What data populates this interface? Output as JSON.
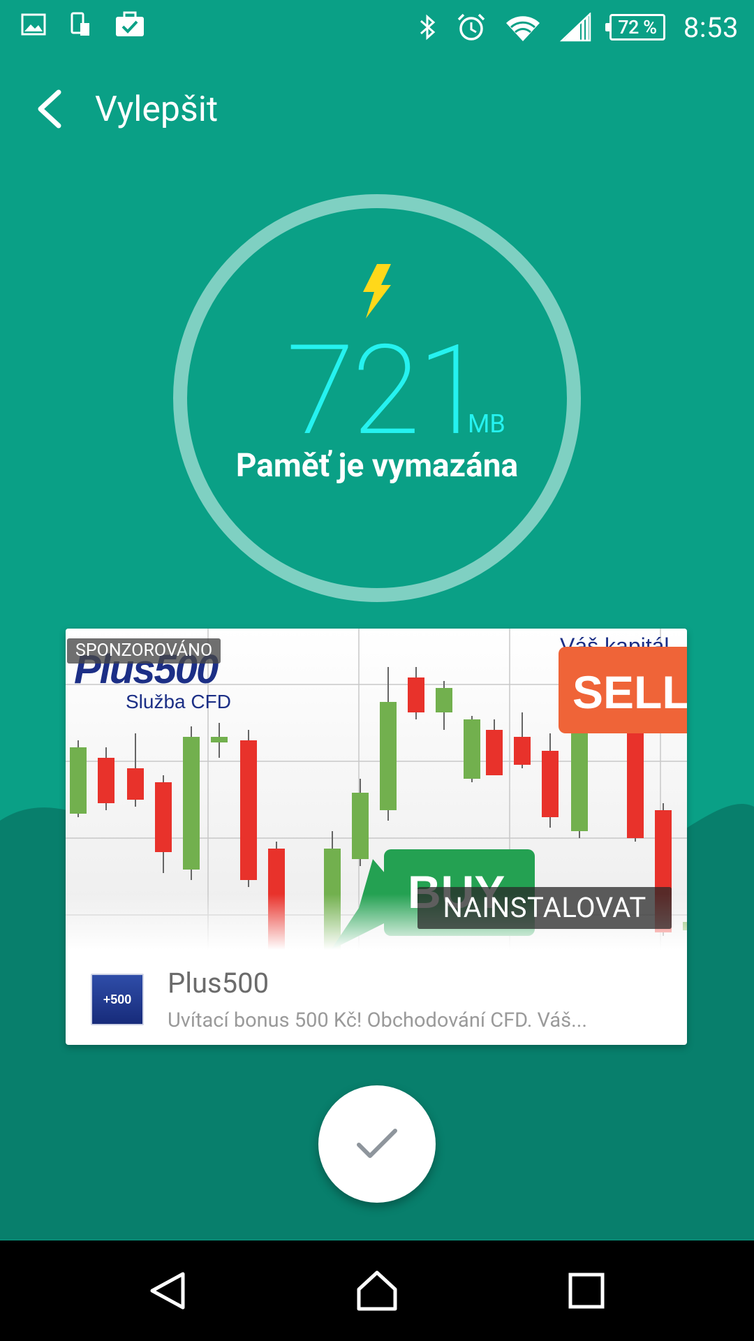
{
  "status_bar": {
    "icons_left": [
      "gallery-icon",
      "phone-sd-icon",
      "briefcase-check-icon"
    ],
    "icons_right": [
      "bluetooth-icon",
      "alarm-icon",
      "wifi-icon",
      "signal-icon"
    ],
    "battery_percent": "72 %",
    "time": "8:53"
  },
  "app_bar": {
    "back_icon": "chevron-left-icon",
    "title": "Vylepšit"
  },
  "memory": {
    "icon": "lightning-bolt-icon",
    "value": "721",
    "unit": "MB",
    "label": "Paměť  je vymazána"
  },
  "ad": {
    "sponsored_label": "SPONZOROVÁNO",
    "banner": {
      "brand": "Plus500",
      "tagline": "Služba CFD",
      "sell_label": "SELL",
      "buy_label": "BUY",
      "corner_text": "Váš kapitál"
    },
    "install_label": "NAINSTALOVAT",
    "app_icon_text": "+500",
    "app_name": "Plus500",
    "description": "Uvítací bonus 500 Kč! Obchodování CFD. Váš..."
  },
  "colors": {
    "background": "#0aa086",
    "hill": "#087f6c",
    "ring": "#7fd0c2",
    "accent_number": "#25f2f0",
    "bolt": "#ffd81a"
  },
  "fab": {
    "icon": "checkmark-icon"
  },
  "nav_bar": {
    "icons": [
      "back-triangle-icon",
      "home-icon",
      "recents-square-icon"
    ]
  }
}
